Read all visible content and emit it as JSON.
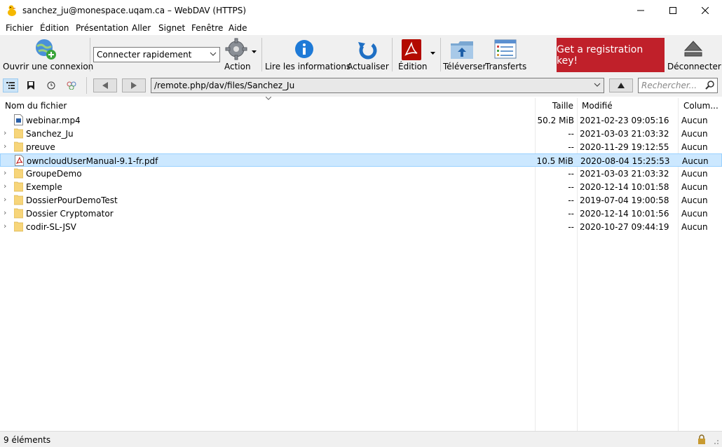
{
  "window": {
    "title": "sanchez_ju@monespace.uqam.ca – WebDAV (HTTPS)",
    "minimize": "—",
    "maximize": "☐",
    "close": "✕"
  },
  "menu": [
    "Fichier",
    "Édition",
    "Présentation",
    "Aller",
    "Signet",
    "Fenêtre",
    "Aide"
  ],
  "toolbar": {
    "open_connection": "Ouvrir une connexion",
    "quick_connect": "Connecter rapidement",
    "action": "Action",
    "info": "Lire les informations",
    "refresh": "Actualiser",
    "edit": "Édition",
    "upload": "Téléverser",
    "transfers": "Transferts",
    "registration": "Get a registration key!",
    "disconnect": "Déconnecter"
  },
  "nav": {
    "path": "/remote.php/dav/files/Sanchez_Ju",
    "search_placeholder": "Rechercher..."
  },
  "columns": {
    "name": "Nom du fichier",
    "size": "Taille",
    "modified": "Modifié",
    "owner": "Colum..."
  },
  "files": [
    {
      "name": "webinar.mp4",
      "size": "50.2 MiB",
      "modified": "2021-02-23 09:05:16",
      "owner": "Aucun",
      "type": "video"
    },
    {
      "name": "Sanchez_Ju",
      "size": "--",
      "modified": "2021-03-03 21:03:32",
      "owner": "Aucun",
      "type": "folder"
    },
    {
      "name": "preuve",
      "size": "--",
      "modified": "2020-11-29 19:12:55",
      "owner": "Aucun",
      "type": "folder"
    },
    {
      "name": "owncloudUserManual-9.1-fr.pdf",
      "size": "10.5 MiB",
      "modified": "2020-08-04 15:25:53",
      "owner": "Aucun",
      "type": "pdf"
    },
    {
      "name": "GroupeDemo",
      "size": "--",
      "modified": "2021-03-03 21:03:32",
      "owner": "Aucun",
      "type": "folder"
    },
    {
      "name": "Exemple",
      "size": "--",
      "modified": "2020-12-14 10:01:58",
      "owner": "Aucun",
      "type": "folder"
    },
    {
      "name": "DossierPourDemoTest",
      "size": "--",
      "modified": "2019-07-04 19:00:58",
      "owner": "Aucun",
      "type": "folder"
    },
    {
      "name": "Dossier Cryptomator",
      "size": "--",
      "modified": "2020-12-14 10:01:56",
      "owner": "Aucun",
      "type": "folder"
    },
    {
      "name": "codir-SL-JSV",
      "size": "--",
      "modified": "2020-10-27 09:44:19",
      "owner": "Aucun",
      "type": "folder"
    }
  ],
  "status": {
    "count": "9 éléments"
  }
}
